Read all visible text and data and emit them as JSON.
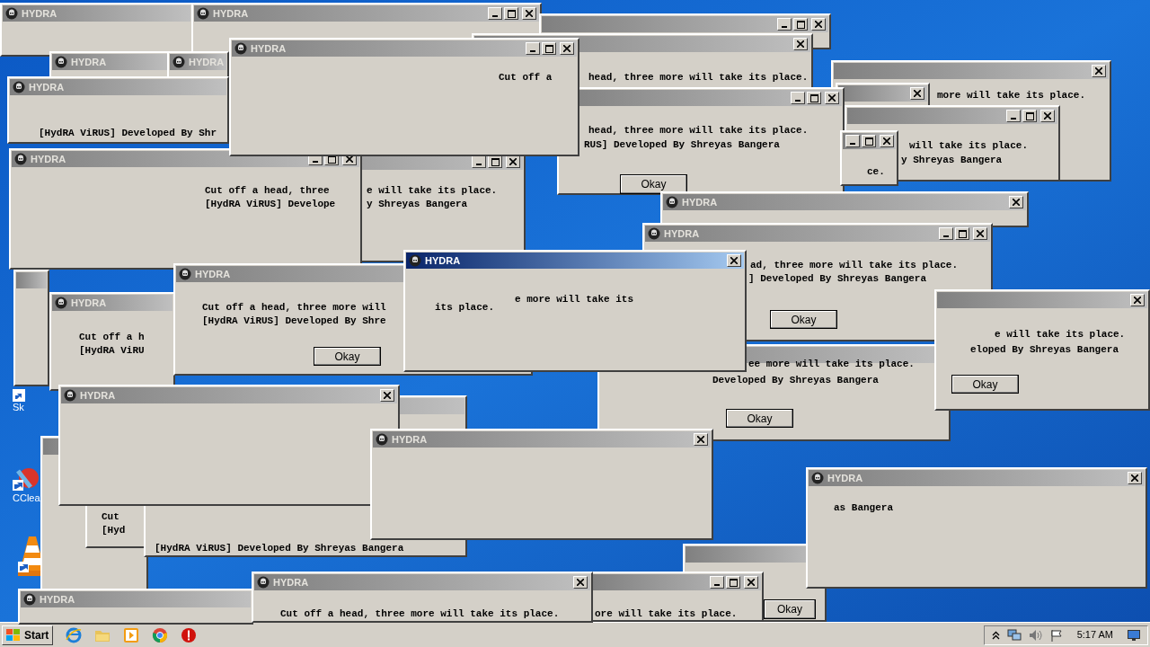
{
  "desktop": {
    "icons": [
      {
        "kind": "shortcut",
        "label": "Sk"
      },
      {
        "kind": "cleaner",
        "label": "CClea"
      },
      {
        "kind": "cone"
      }
    ]
  },
  "windows": [
    {
      "title": "HYDRA",
      "active": false
    },
    {
      "title": "HYDRA",
      "active": false,
      "controls": [
        {
          "kind": "minimize"
        },
        {
          "kind": "maximize"
        },
        {
          "kind": "close"
        }
      ]
    },
    {
      "active": false,
      "controls": [
        {
          "kind": "minimize"
        },
        {
          "kind": "maximize"
        },
        {
          "kind": "close"
        }
      ]
    },
    {
      "active": false,
      "controls": [
        {
          "kind": "close"
        }
      ],
      "lines": [
        "head, three more will take its place."
      ]
    },
    {
      "active": false,
      "controls": [
        {
          "kind": "close"
        }
      ],
      "lines": [
        "more will take its place."
      ]
    },
    {
      "active": false,
      "controls": [
        {
          "kind": "close"
        }
      ]
    },
    {
      "active": false,
      "controls": [
        {
          "kind": "minimize"
        },
        {
          "kind": "maximize"
        },
        {
          "kind": "close"
        }
      ],
      "lines": [
        "will take its place.",
        "y Shreyas Bangera"
      ]
    },
    {
      "active": false,
      "controls": [
        {
          "kind": "minimize"
        },
        {
          "kind": "maximize"
        },
        {
          "kind": "close"
        }
      ],
      "lines": [
        "head, three more will take its place.",
        "RUS] Developed By Shreyas Bangera"
      ],
      "button": "Okay"
    },
    {
      "active": false,
      "controls": [
        {
          "kind": "minimize"
        },
        {
          "kind": "maximize"
        },
        {
          "kind": "close"
        }
      ],
      "lines": [
        "ce."
      ]
    },
    {
      "title": "HYDRA",
      "active": false
    },
    {
      "title": "HYDRA",
      "active": false
    },
    {
      "title": "HYDRA",
      "active": false,
      "lines": [
        "[HydRA ViRUS] Developed By Shr"
      ]
    },
    {
      "title": "HYDRA",
      "active": false,
      "controls": [
        {
          "kind": "minimize"
        },
        {
          "kind": "maximize"
        },
        {
          "kind": "close"
        }
      ],
      "lines": [
        "Cut off a head, three",
        "[HydRA ViRUS] Develope"
      ]
    },
    {
      "active": false,
      "controls": [
        {
          "kind": "minimize"
        },
        {
          "kind": "maximize"
        },
        {
          "kind": "close"
        }
      ],
      "lines": [
        "e will take its place.",
        "y Shreyas Bangera"
      ]
    },
    {
      "title": "HYDRA",
      "active": false,
      "controls": [
        {
          "kind": "minimize"
        },
        {
          "kind": "maximize"
        },
        {
          "kind": "close"
        }
      ],
      "lines": [
        "Cut off a"
      ]
    },
    {
      "active": false
    },
    {
      "active": false
    },
    {
      "title": "HYDRA",
      "active": false,
      "lines": [
        "Cut off a h",
        "[HydRA ViRU"
      ]
    },
    {
      "title": "HYDRA",
      "active": false,
      "lines": [
        "Cut off a head, three more will",
        "[HydRA ViRUS] Developed By Shre"
      ],
      "button": "Okay"
    },
    {
      "title": "HYDRA",
      "active": false,
      "controls": [
        {
          "kind": "close"
        }
      ]
    },
    {
      "title": "HYDRA",
      "active": false,
      "controls": [
        {
          "kind": "minimize"
        },
        {
          "kind": "maximize"
        },
        {
          "kind": "close"
        }
      ],
      "lines": [
        "ad, three more will take its place.",
        "] Developed By Shreyas Bangera"
      ],
      "button": "Okay"
    },
    {
      "active": false,
      "lines": [
        "ee more will take its place.",
        "Developed By Shreyas Bangera"
      ],
      "button": "Okay"
    },
    {
      "active": false,
      "controls": [
        {
          "kind": "close"
        }
      ],
      "lines": [
        "e will take its place.",
        "eloped By Shreyas Bangera"
      ],
      "button": "Okay"
    },
    {
      "title": "HYDRA",
      "active": true,
      "controls": [
        {
          "kind": "close"
        }
      ],
      "lines": [
        "its place.",
        "e more will take its"
      ]
    },
    {
      "lines": [
        "Cut",
        "[Hyd"
      ]
    },
    {
      "active": false,
      "lines": [
        "[HydRA ViRUS] Developed By Shreyas Bangera"
      ]
    },
    {
      "title": "HYDRA",
      "active": false,
      "controls": [
        {
          "kind": "close"
        }
      ]
    },
    {
      "title": "HYDRA",
      "active": false,
      "controls": [
        {
          "kind": "close"
        }
      ]
    },
    {
      "active": false,
      "button": "Okay"
    },
    {
      "title": "HYDRA",
      "active": false,
      "controls": [
        {
          "kind": "close"
        }
      ],
      "lines": [
        "as Bangera"
      ]
    },
    {
      "active": false,
      "controls": [
        {
          "kind": "minimize"
        },
        {
          "kind": "maximize"
        },
        {
          "kind": "close"
        }
      ],
      "lines": [
        "ore will take its place."
      ]
    },
    {
      "title": "HYDRA",
      "active": false
    },
    {
      "title": "HYDRA",
      "active": false,
      "controls": [
        {
          "kind": "close"
        }
      ],
      "lines": [
        "Cut off a head, three more will take its place."
      ]
    }
  ],
  "taskbar": {
    "start": "Start",
    "apps": [
      {
        "kind": "browser"
      },
      {
        "kind": "folder"
      },
      {
        "kind": "media"
      },
      {
        "kind": "chrome"
      },
      {
        "kind": "stop"
      }
    ],
    "clock": "5:17 AM"
  }
}
